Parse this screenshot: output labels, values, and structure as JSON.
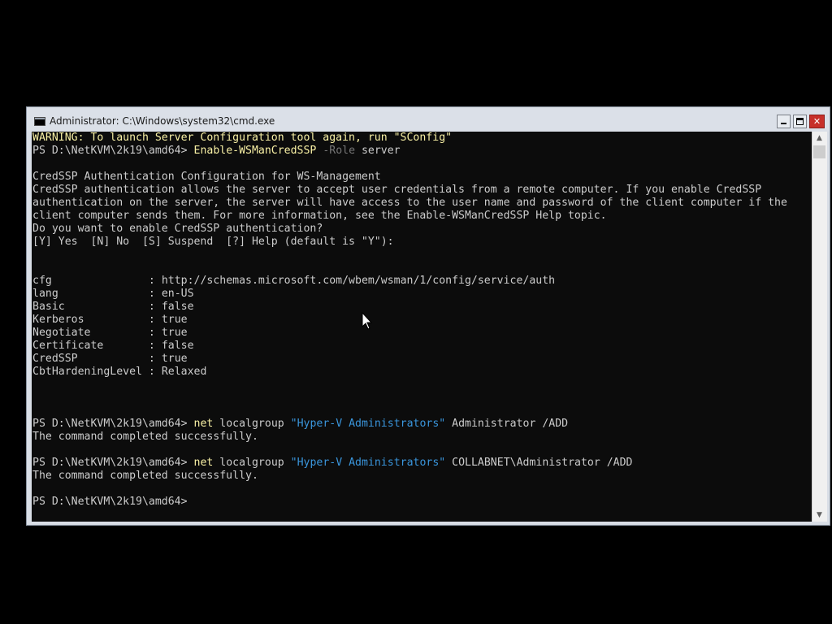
{
  "window": {
    "title": "Administrator: C:\\Windows\\system32\\cmd.exe",
    "icon": "cmd-app-icon",
    "buttons": {
      "minimize": "minimize-icon",
      "maximize": "maximize-icon",
      "close": "✕"
    }
  },
  "colors": {
    "console_bg": "#0c0c0c",
    "console_text": "#cccccc",
    "warning": "#f9f1a5",
    "string": "#3a96dd",
    "parameter": "#767676"
  },
  "console": {
    "warning": "WARNING: To launch Server Configuration tool again, run \"SConfig\"",
    "prompt": "PS D:\\NetKVM\\2k19\\amd64>",
    "cmd1": {
      "command": "Enable-WSManCredSSP",
      "param": "-Role",
      "arg": "server"
    },
    "credssp_title": "CredSSP Authentication Configuration for WS-Management",
    "credssp_body": [
      "CredSSP authentication allows the server to accept user credentials from a remote computer. If you enable CredSSP",
      "authentication on the server, the server will have access to the user name and password of the client computer if the",
      "client computer sends them. For more information, see the Enable-WSManCredSSP Help topic.",
      "Do you want to enable CredSSP authentication?",
      "[Y] Yes  [N] No  [S] Suspend  [?] Help (default is \"Y\"):"
    ],
    "properties": [
      {
        "key": "cfg               ",
        "value": "http://schemas.microsoft.com/wbem/wsman/1/config/service/auth"
      },
      {
        "key": "lang              ",
        "value": "en-US"
      },
      {
        "key": "Basic             ",
        "value": "false"
      },
      {
        "key": "Kerberos          ",
        "value": "true"
      },
      {
        "key": "Negotiate         ",
        "value": "true"
      },
      {
        "key": "Certificate       ",
        "value": "false"
      },
      {
        "key": "CredSSP           ",
        "value": "true"
      },
      {
        "key": "CbtHardeningLevel ",
        "value": "Relaxed"
      }
    ],
    "cmd2": {
      "command": "net",
      "args1": "localgroup",
      "string": "\"Hyper-V Administrators\"",
      "args2": "Administrator /ADD"
    },
    "cmd3": {
      "command": "net",
      "args1": "localgroup",
      "string": "\"Hyper-V Administrators\"",
      "args2": "COLLABNET\\Administrator /ADD"
    },
    "success": "The command completed successfully."
  },
  "scrollbar": {
    "up": "▲",
    "down": "▼"
  }
}
